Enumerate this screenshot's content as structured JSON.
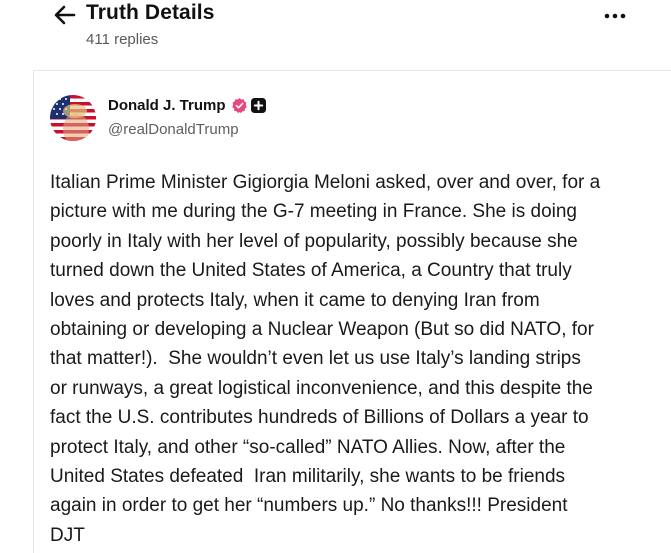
{
  "header": {
    "title": "Truth Details",
    "reply_count": "411 replies",
    "back_icon": "arrow-left-icon",
    "more_icon": "more-horizontal-icon"
  },
  "author": {
    "name": "Donald J. Trump",
    "handle": "@realDonaldTrump",
    "verified_icon": "verified-badge-icon",
    "verified_color": "#e8467c",
    "plus_icon": "plus-badge-icon"
  },
  "post": {
    "lines": [
      "Italian Prime Minister Gigiorgia Meloni asked, over and over, for a",
      "picture with me during the G-7 meeting in France. She is doing",
      "poorly in Italy with her level of popularity, possibly because she",
      "turned down the United States of America, a Country that truly",
      "loves and protects Italy, when it came to denying Iran from",
      "obtaining or developing a Nuclear Weapon (But so did NATO, for",
      "that matter!).  She wouldn’t even let us use Italy’s landing strips",
      "or runways, a great logistical inconvenience, and this despite the",
      "fact the U.S. contributes hundreds of Billions of Dollars a year to",
      "protect Italy, and other “so-called” NATO Allies. Now, after the",
      "United States defeated  Iran militarily, she wants to be friends",
      "again in order to get her “numbers up.” No thanks!!! President",
      "DJT"
    ]
  }
}
